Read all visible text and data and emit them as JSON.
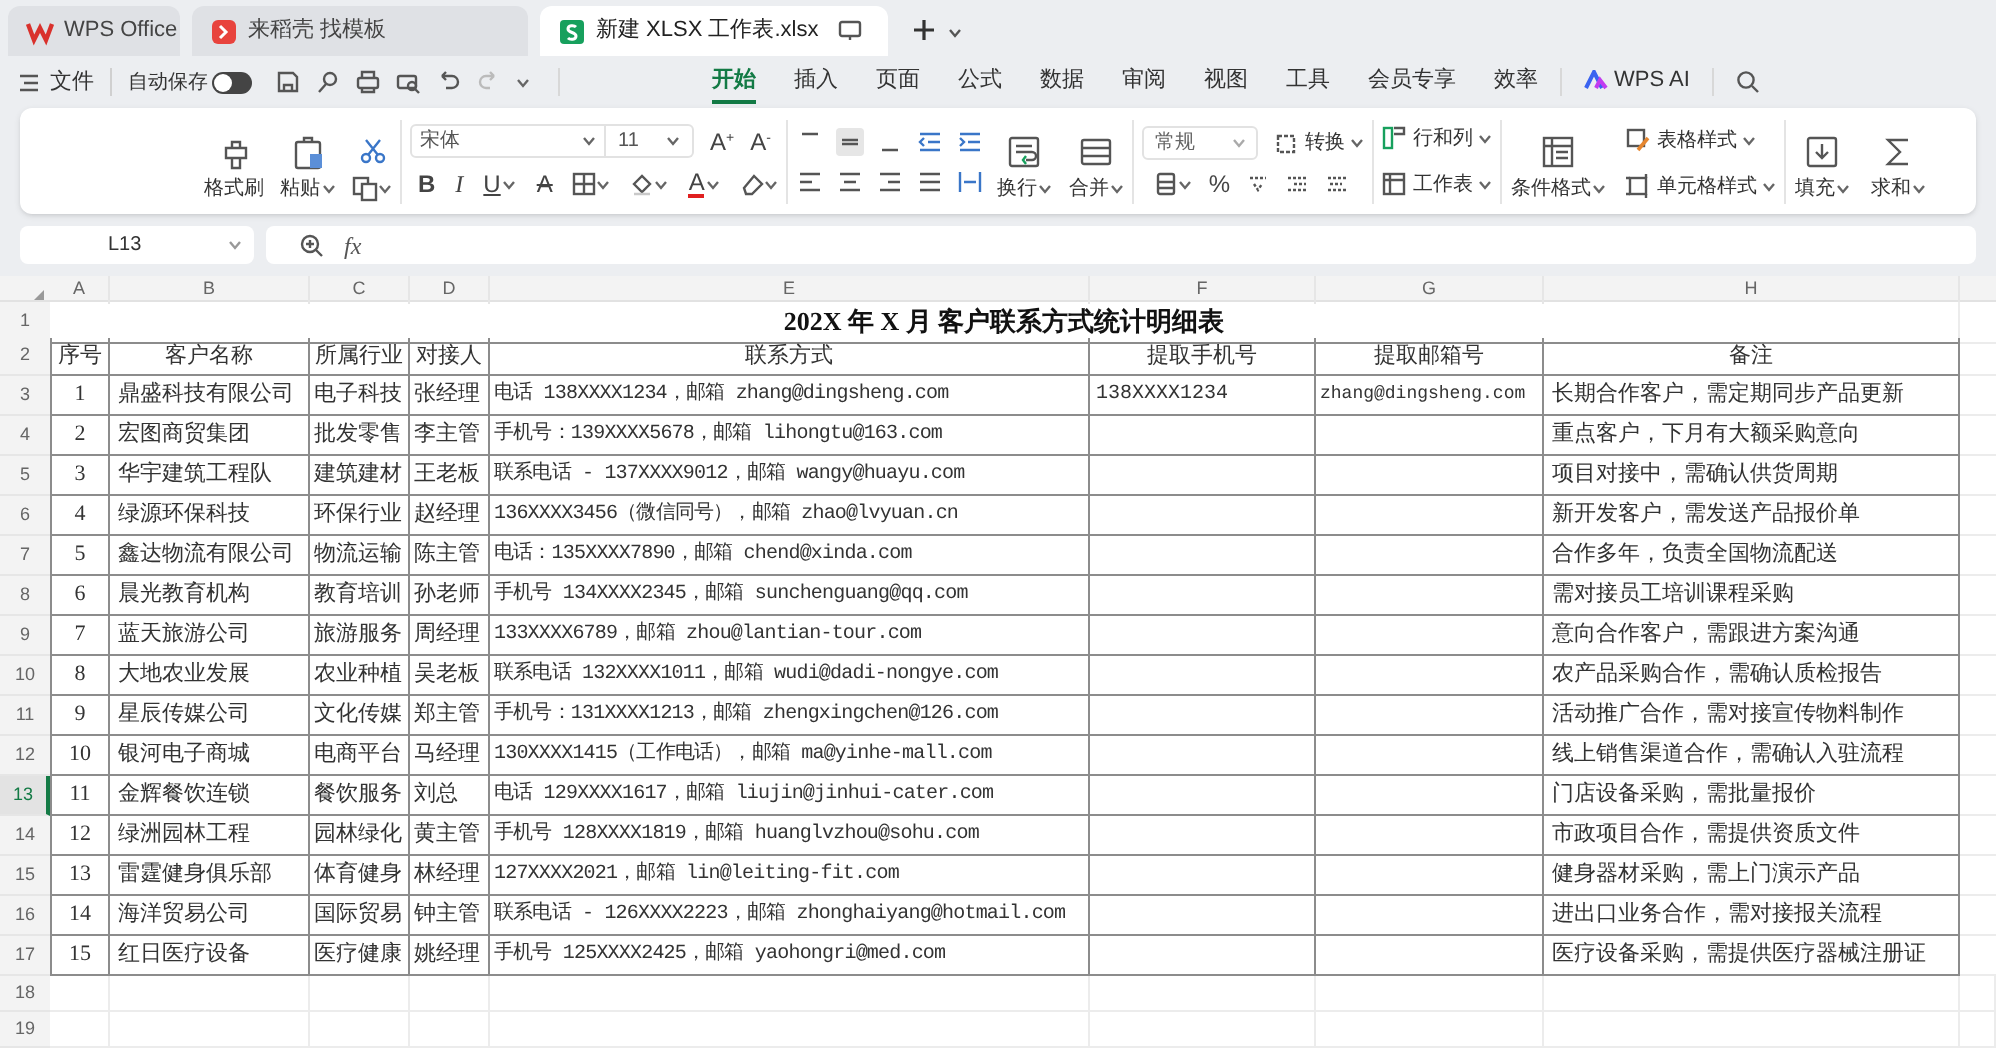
{
  "tabs": [
    {
      "label": "WPS Office",
      "kind": "app",
      "selected": false
    },
    {
      "label": "来稻壳 找模板",
      "kind": "template",
      "selected": false
    },
    {
      "label": "新建 XLSX 工作表.xlsx",
      "kind": "sheet",
      "selected": true
    }
  ],
  "quick_bar": {
    "file_menu": "文件",
    "autosave": {
      "label": "自动保存",
      "on": false
    }
  },
  "menu_tabs": [
    {
      "label": "开始",
      "kind": "text",
      "selected": true
    },
    {
      "label": "插入",
      "kind": "text",
      "selected": false
    },
    {
      "label": "页面",
      "kind": "text",
      "selected": false
    },
    {
      "label": "公式",
      "kind": "text",
      "selected": false
    },
    {
      "label": "数据",
      "kind": "text",
      "selected": false
    },
    {
      "label": "审阅",
      "kind": "text",
      "selected": false
    },
    {
      "label": "视图",
      "kind": "text",
      "selected": false
    },
    {
      "label": "工具",
      "kind": "text",
      "selected": false
    },
    {
      "label": "会员专享",
      "kind": "text",
      "selected": false
    },
    {
      "label": "效率",
      "kind": "text",
      "selected": false
    },
    {
      "label": "WPS AI",
      "kind": "ai",
      "selected": false
    }
  ],
  "ribbon": {
    "format_painter": "格式刷",
    "paste": "粘贴",
    "font": "宋体",
    "font_size": "11",
    "grow": "A",
    "grow_sign": "+",
    "shrink": "A",
    "shrink_sign": "-",
    "bold": "B",
    "italic": "I",
    "underline": "U",
    "strike": "A",
    "font_color": "A",
    "wrap": "换行",
    "merge": "合并",
    "number_format": "常规",
    "convert": "转换",
    "percent": "%",
    "rows_cols": "行和列",
    "worksheet": "工作表",
    "conditional_format": "条件格式",
    "table_style": "表格样式",
    "cell_style": "单元格样式",
    "fill": "填充",
    "sum": "求和"
  },
  "formula_bar": {
    "cell_ref": "L13",
    "fx": "fx"
  },
  "sheet": {
    "columns": [
      "A",
      "B",
      "C",
      "D",
      "E",
      "F",
      "G",
      "H"
    ],
    "row_headers": [
      {
        "label": "1",
        "selected": false
      },
      {
        "label": "2",
        "selected": false
      },
      {
        "label": "3",
        "selected": false
      },
      {
        "label": "4",
        "selected": false
      },
      {
        "label": "5",
        "selected": false
      },
      {
        "label": "6",
        "selected": false
      },
      {
        "label": "7",
        "selected": false
      },
      {
        "label": "8",
        "selected": false
      },
      {
        "label": "9",
        "selected": false
      },
      {
        "label": "10",
        "selected": false
      },
      {
        "label": "11",
        "selected": false
      },
      {
        "label": "12",
        "selected": false
      },
      {
        "label": "13",
        "selected": true
      },
      {
        "label": "14",
        "selected": false
      },
      {
        "label": "15",
        "selected": false
      },
      {
        "label": "16",
        "selected": false
      },
      {
        "label": "17",
        "selected": false
      },
      {
        "label": "18",
        "selected": false
      },
      {
        "label": "19",
        "selected": false
      }
    ],
    "title": "202X 年 X 月 客户联系方式统计明细表",
    "header": [
      "序号",
      "客户名称",
      "所属行业",
      "对接人",
      "联系方式",
      "提取手机号",
      "提取邮箱号",
      "备注"
    ],
    "records": [
      {
        "no": "1",
        "name": "鼎盛科技有限公司",
        "industry": "电子科技",
        "contact": "张经理",
        "method": "电话 138XXXX1234，邮箱 zhang@dingsheng.com",
        "phone": "138XXXX1234",
        "email": "zhang@dingsheng.com",
        "note": "长期合作客户，需定期同步产品更新"
      },
      {
        "no": "2",
        "name": "宏图商贸集团",
        "industry": "批发零售",
        "contact": "李主管",
        "method": "手机号：139XXXX5678，邮箱 lihongtu@163.com",
        "note": "重点客户，下月有大额采购意向"
      },
      {
        "no": "3",
        "name": "华宇建筑工程队",
        "industry": "建筑建材",
        "contact": "王老板",
        "method": "联系电话 - 137XXXX9012，邮箱 wangy@huayu.com",
        "note": "项目对接中，需确认供货周期"
      },
      {
        "no": "4",
        "name": "绿源环保科技",
        "industry": "环保行业",
        "contact": "赵经理",
        "method": "136XXXX3456（微信同号），邮箱 zhao@lvyuan.cn",
        "note": "新开发客户，需发送产品报价单"
      },
      {
        "no": "5",
        "name": "鑫达物流有限公司",
        "industry": "物流运输",
        "contact": "陈主管",
        "method": "电话：135XXXX7890，邮箱 chend@xinda.com",
        "note": "合作多年，负责全国物流配送"
      },
      {
        "no": "6",
        "name": "晨光教育机构",
        "industry": "教育培训",
        "contact": "孙老师",
        "method": "手机号 134XXXX2345，邮箱 sunchenguang@qq.com",
        "note": "需对接员工培训课程采购"
      },
      {
        "no": "7",
        "name": "蓝天旅游公司",
        "industry": "旅游服务",
        "contact": "周经理",
        "method": "133XXXX6789，邮箱 zhou@lantian-tour.com",
        "note": "意向合作客户，需跟进方案沟通"
      },
      {
        "no": "8",
        "name": "大地农业发展",
        "industry": "农业种植",
        "contact": "吴老板",
        "method": "联系电话 132XXXX1011，邮箱 wudi@dadi-nongye.com",
        "note": "农产品采购合作，需确认质检报告"
      },
      {
        "no": "9",
        "name": "星辰传媒公司",
        "industry": "文化传媒",
        "contact": "郑主管",
        "method": "手机号：131XXXX1213，邮箱 zhengxingchen@126.com",
        "note": "活动推广合作，需对接宣传物料制作"
      },
      {
        "no": "10",
        "name": "银河电子商城",
        "industry": "电商平台",
        "contact": "马经理",
        "method": "130XXXX1415（工作电话），邮箱 ma@yinhe-mall.com",
        "note": "线上销售渠道合作，需确认入驻流程"
      },
      {
        "no": "11",
        "name": "金辉餐饮连锁",
        "industry": "餐饮服务",
        "contact": "刘总",
        "method": "电话 129XXXX1617，邮箱 liujin@jinhui-cater.com",
        "note": "门店设备采购，需批量报价"
      },
      {
        "no": "12",
        "name": "绿洲园林工程",
        "industry": "园林绿化",
        "contact": "黄主管",
        "method": "手机号 128XXXX1819，邮箱 huanglvzhou@sohu.com",
        "note": "市政项目合作，需提供资质文件"
      },
      {
        "no": "13",
        "name": "雷霆健身俱乐部",
        "industry": "体育健身",
        "contact": "林经理",
        "method": "127XXXX2021，邮箱 lin@leiting-fit.com",
        "note": "健身器材采购，需上门演示产品"
      },
      {
        "no": "14",
        "name": "海洋贸易公司",
        "industry": "国际贸易",
        "contact": "钟主管",
        "method": "联系电话 - 126XXXX2223，邮箱 zhonghaiyang@hotmail.com",
        "note": "进出口业务合作，需对接报关流程"
      },
      {
        "no": "15",
        "name": "红日医疗设备",
        "industry": "医疗健康",
        "contact": "姚经理",
        "method": "手机号 125XXXX2425，邮箱 yaohongri@med.com",
        "note": "医疗设备采购，需提供医疗器械注册证"
      }
    ]
  }
}
